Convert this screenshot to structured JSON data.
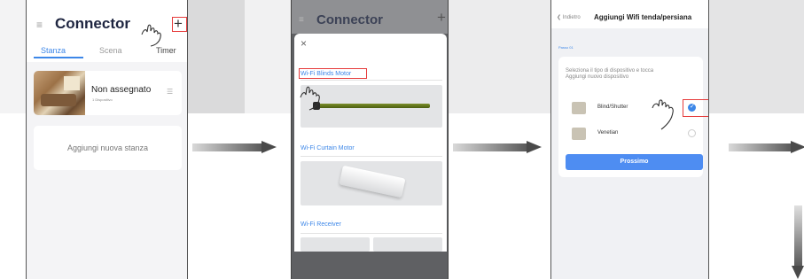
{
  "phone1": {
    "app_title": "Connector",
    "menu_icon": "≡",
    "add_icon": "+",
    "tabs": [
      "Stanza",
      "Scena",
      "Timer"
    ],
    "room_card": {
      "name": "Non assegnato",
      "sub": "1 Dispositivo",
      "settings_icon": "☰"
    },
    "add_room": "Aggiungi nuova stanza"
  },
  "phone2": {
    "app_title": "Connector",
    "menu_icon": "≡",
    "add_icon": "+",
    "close_icon": "×",
    "sections": [
      "Wi-Fi Blinds Motor",
      "Wi-Fi Curtain Motor",
      "Wi-Fi Receiver"
    ]
  },
  "phone3": {
    "back_label": "❮ Indietro",
    "title": "Aggiungi Wifi tenda/persiana",
    "step": "Passo 01",
    "description_line1": "Seleziona il tipo di dispositivo e tocca",
    "description_line2": "Aggiungi nuovo dispositivo",
    "options": [
      "Blind/Shutter",
      "Venetian"
    ],
    "selected_index": 0,
    "next_button": "Prossimo"
  },
  "colors": {
    "accent_blue": "#3d87e8",
    "highlight_red": "#e63b3b",
    "title_navy": "#1e2540",
    "button_blue": "#4e8df2"
  },
  "icons": [
    "menu-icon",
    "plus-icon",
    "close-icon",
    "hand-pointer-icon",
    "arrow-right-icon",
    "arrow-down-icon",
    "check-icon"
  ]
}
